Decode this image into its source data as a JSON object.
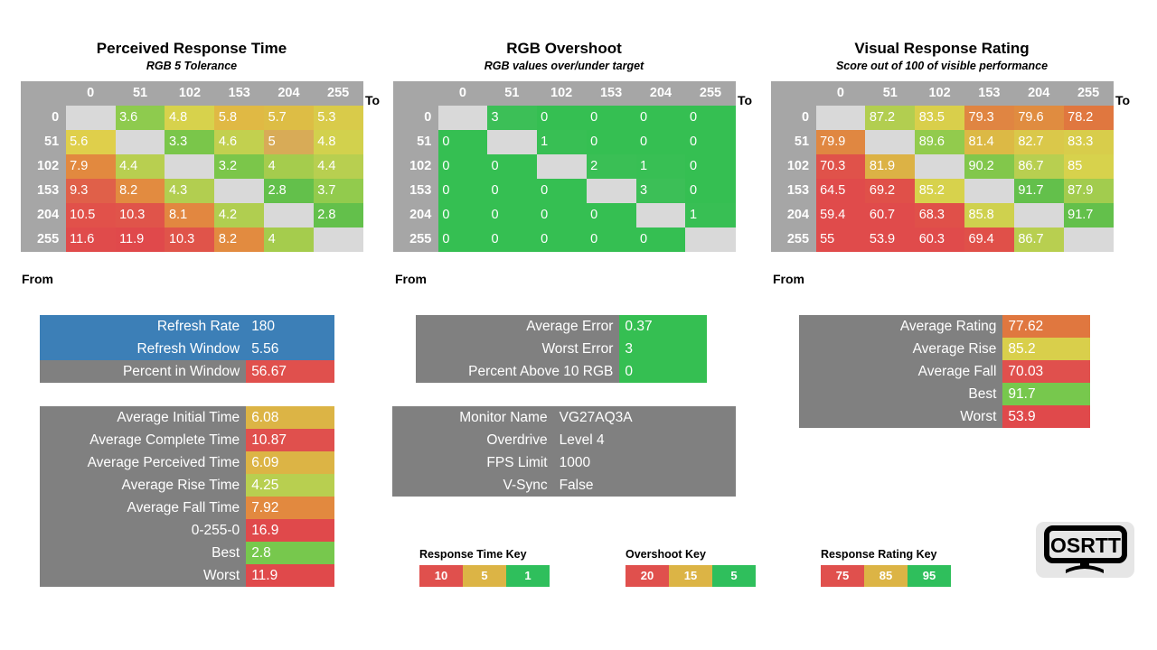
{
  "colors": {
    "header_grey": "#a6a6a6",
    "diag_grey": "#d9d9d9",
    "box_grey": "#808080",
    "blue": "#3c7fb7",
    "red": "#e0504d",
    "amber": "#dcb446",
    "green": "#2fbf5c",
    "logo_bg": "#e6e6e6"
  },
  "panels": [
    {
      "id": "perceived-response-time",
      "title": "Perceived Response Time",
      "subtitle": "RGB 5 Tolerance",
      "to_label": "To",
      "from_label": "From",
      "columns": [
        "0",
        "51",
        "102",
        "153",
        "204",
        "255"
      ],
      "rows": [
        "0",
        "51",
        "102",
        "153",
        "204",
        "255"
      ],
      "values": [
        [
          null,
          "3.6",
          "4.8",
          "5.8",
          "5.7",
          "5.3"
        ],
        [
          "5.6",
          null,
          "3.3",
          "4.6",
          "5",
          "4.8"
        ],
        [
          "7.9",
          "4.4",
          null,
          "3.2",
          "4",
          "4.4"
        ],
        [
          "9.3",
          "8.2",
          "4.3",
          null,
          "2.8",
          "3.7"
        ],
        [
          "10.5",
          "10.3",
          "8.1",
          "4.2",
          null,
          "2.8"
        ],
        [
          "11.6",
          "11.9",
          "10.3",
          "8.2",
          "4",
          null
        ]
      ],
      "cell_colors": [
        [
          null,
          "#8ecb4e",
          "#d7d24c",
          "#e0b944",
          "#ddbd45",
          "#d9cb4a"
        ],
        [
          "#dfcf4b",
          null,
          "#7ac64a",
          "#c2d04f",
          "#d8ab57",
          "#d2d14d"
        ],
        [
          "#e2893f",
          "#b8cf50",
          null,
          "#7bc64a",
          "#a5cc4d",
          "#b8cf50"
        ],
        [
          "#e06049",
          "#e28b40",
          "#b2ce50",
          null,
          "#63c04b",
          "#92cb4d"
        ],
        [
          "#e1514a",
          "#e0544a",
          "#e28740",
          "#b0ce50",
          null,
          "#63c04b"
        ],
        [
          "#e04b4b",
          "#e0494b",
          "#e0544a",
          "#e28b40",
          "#a5cc4d",
          null
        ]
      ]
    },
    {
      "id": "rgb-overshoot",
      "title": "RGB Overshoot",
      "subtitle": "RGB values over/under target",
      "to_label": "To",
      "from_label": "From",
      "columns": [
        "0",
        "51",
        "102",
        "153",
        "204",
        "255"
      ],
      "rows": [
        "0",
        "51",
        "102",
        "153",
        "204",
        "255"
      ],
      "values": [
        [
          null,
          "3",
          "0",
          "0",
          "0",
          "0"
        ],
        [
          "0",
          null,
          "1",
          "0",
          "0",
          "0"
        ],
        [
          "0",
          "0",
          null,
          "2",
          "1",
          "0"
        ],
        [
          "0",
          "0",
          "0",
          null,
          "3",
          "0"
        ],
        [
          "0",
          "0",
          "0",
          "0",
          null,
          "1"
        ],
        [
          "0",
          "0",
          "0",
          "0",
          "0",
          null
        ]
      ],
      "cell_colors": [
        [
          null,
          "#3cbf57",
          "#35bf52",
          "#35bf52",
          "#35bf52",
          "#35bf52"
        ],
        [
          "#35bf52",
          null,
          "#38bf54",
          "#35bf52",
          "#35bf52",
          "#35bf52"
        ],
        [
          "#35bf52",
          "#35bf52",
          null,
          "#3abf55",
          "#38bf54",
          "#35bf52"
        ],
        [
          "#35bf52",
          "#35bf52",
          "#35bf52",
          null,
          "#3cbf57",
          "#35bf52"
        ],
        [
          "#35bf52",
          "#35bf52",
          "#35bf52",
          "#35bf52",
          null,
          "#38bf54"
        ],
        [
          "#35bf52",
          "#35bf52",
          "#35bf52",
          "#35bf52",
          "#35bf52",
          null
        ]
      ]
    },
    {
      "id": "visual-response-rating",
      "title": "Visual Response Rating",
      "subtitle": "Score out of 100 of visible performance",
      "to_label": "To",
      "from_label": "From",
      "columns": [
        "0",
        "51",
        "102",
        "153",
        "204",
        "255"
      ],
      "rows": [
        "0",
        "51",
        "102",
        "153",
        "204",
        "255"
      ],
      "values": [
        [
          null,
          "87.2",
          "83.5",
          "79.3",
          "79.6",
          "78.2"
        ],
        [
          "79.9",
          null,
          "89.6",
          "81.4",
          "82.7",
          "83.3"
        ],
        [
          "70.3",
          "81.9",
          null,
          "90.2",
          "86.7",
          "85"
        ],
        [
          "64.5",
          "69.2",
          "85.2",
          null,
          "91.7",
          "87.9"
        ],
        [
          "59.4",
          "60.7",
          "68.3",
          "85.8",
          null,
          "91.7"
        ],
        [
          "55",
          "53.9",
          "60.3",
          "69.4",
          "86.7",
          null
        ]
      ],
      "cell_colors": [
        [
          null,
          "#b2ce50",
          "#d9cf4b",
          "#e08542",
          "#e08c40",
          "#e0773f"
        ],
        [
          "#e08741",
          null,
          "#92cb4d",
          "#dcb945",
          "#dac84a",
          "#d8cd4b"
        ],
        [
          "#e0524a",
          "#dcb245",
          null,
          "#82c74b",
          "#b8cf50",
          "#d7d24c"
        ],
        [
          "#e04b4b",
          "#e05049",
          "#d7d24c",
          null,
          "#63c04b",
          "#a2cc4e"
        ],
        [
          "#e04b4b",
          "#e04b4b",
          "#e05049",
          "#cfd14e",
          null,
          "#63c04b"
        ],
        [
          "#e04b4b",
          "#e04b4b",
          "#e04b4b",
          "#e05049",
          "#b8cf50",
          null
        ]
      ]
    }
  ],
  "summaries": {
    "refresh": {
      "id": "refresh-summary",
      "rows": [
        {
          "key": "Refresh Rate",
          "value": "180",
          "key_bg": "#3c7fb7",
          "value_bg": "#3c7fb7"
        },
        {
          "key": "Refresh Window",
          "value": "5.56",
          "key_bg": "#3c7fb7",
          "value_bg": "#3c7fb7"
        },
        {
          "key": "Percent in Window",
          "value": "56.67",
          "key_bg": "#808080",
          "value_bg": "#e0504d"
        }
      ]
    },
    "times": {
      "id": "response-time-summary",
      "rows": [
        {
          "key": "Average Initial Time",
          "value": "6.08",
          "key_bg": "#808080",
          "value_bg": "#dcb445"
        },
        {
          "key": "Average Complete Time",
          "value": "10.87",
          "key_bg": "#808080",
          "value_bg": "#e0504d"
        },
        {
          "key": "Average Perceived Time",
          "value": "6.09",
          "key_bg": "#808080",
          "value_bg": "#dcb445"
        },
        {
          "key": "Average Rise Time",
          "value": "4.25",
          "key_bg": "#808080",
          "value_bg": "#b8cf50"
        },
        {
          "key": "Average Fall Time",
          "value": "7.92",
          "key_bg": "#808080",
          "value_bg": "#e2893f"
        },
        {
          "key": "0-255-0",
          "value": "16.9",
          "key_bg": "#808080",
          "value_bg": "#e0494b"
        },
        {
          "key": "Best",
          "value": "2.8",
          "key_bg": "#808080",
          "value_bg": "#77c84d"
        },
        {
          "key": "Worst",
          "value": "11.9",
          "key_bg": "#808080",
          "value_bg": "#e0494b"
        }
      ]
    },
    "overshoot": {
      "id": "overshoot-summary",
      "rows": [
        {
          "key": "Average Error",
          "value": "0.37",
          "key_bg": "#808080",
          "value_bg": "#35bf52"
        },
        {
          "key": "Worst Error",
          "value": "3",
          "key_bg": "#808080",
          "value_bg": "#35bf52"
        },
        {
          "key": "Percent Above 10 RGB",
          "value": "0",
          "key_bg": "#808080",
          "value_bg": "#35bf52"
        }
      ]
    },
    "monitor": {
      "id": "monitor-info",
      "rows": [
        {
          "key": "Monitor Name",
          "value": "VG27AQ3A",
          "key_bg": "#808080",
          "value_bg": "#808080"
        },
        {
          "key": "Overdrive",
          "value": "Level 4",
          "key_bg": "#808080",
          "value_bg": "#808080"
        },
        {
          "key": "FPS Limit",
          "value": "1000",
          "key_bg": "#808080",
          "value_bg": "#808080"
        },
        {
          "key": "V-Sync",
          "value": "False",
          "key_bg": "#808080",
          "value_bg": "#808080"
        }
      ]
    },
    "rating": {
      "id": "rating-summary",
      "rows": [
        {
          "key": "Average Rating",
          "value": "77.62",
          "key_bg": "#808080",
          "value_bg": "#e0773f"
        },
        {
          "key": "Average Rise",
          "value": "85.2",
          "key_bg": "#808080",
          "value_bg": "#d9cf4b"
        },
        {
          "key": "Average Fall",
          "value": "70.03",
          "key_bg": "#808080",
          "value_bg": "#e0504d"
        },
        {
          "key": "Best",
          "value": "91.7",
          "key_bg": "#808080",
          "value_bg": "#77c84d"
        },
        {
          "key": "Worst",
          "value": "53.9",
          "key_bg": "#808080",
          "value_bg": "#e0494b"
        }
      ]
    }
  },
  "keys": [
    {
      "id": "response-time-key",
      "title": "Response Time Key",
      "stops": [
        {
          "label": "10",
          "color": "#e0504d"
        },
        {
          "label": "5",
          "color": "#dcb445"
        },
        {
          "label": "1",
          "color": "#2fbf5c"
        }
      ]
    },
    {
      "id": "overshoot-key",
      "title": "Overshoot Key",
      "stops": [
        {
          "label": "20",
          "color": "#e0504d"
        },
        {
          "label": "15",
          "color": "#dcb445"
        },
        {
          "label": "5",
          "color": "#2fbf5c"
        }
      ]
    },
    {
      "id": "response-rating-key",
      "title": "Response Rating Key",
      "stops": [
        {
          "label": "75",
          "color": "#e0504d"
        },
        {
          "label": "85",
          "color": "#dcb445"
        },
        {
          "label": "95",
          "color": "#2fbf5c"
        }
      ]
    }
  ],
  "logo": {
    "text": "OSRTT",
    "icon": "monitor-icon"
  },
  "chart_data": {
    "type": "heatmap",
    "title": "OSRTT Monitor Response Time Results",
    "charts": [
      {
        "type": "heatmap",
        "title": "Perceived Response Time",
        "subtitle": "RGB 5 Tolerance",
        "xlabel": "To",
        "ylabel": "From",
        "x": [
          0,
          51,
          102,
          153,
          204,
          255
        ],
        "y": [
          0,
          51,
          102,
          153,
          204,
          255
        ],
        "z": [
          [
            null,
            3.6,
            4.8,
            5.8,
            5.7,
            5.3
          ],
          [
            5.6,
            null,
            3.3,
            4.6,
            5,
            4.8
          ],
          [
            7.9,
            4.4,
            null,
            3.2,
            4,
            4.4
          ],
          [
            9.3,
            8.2,
            4.3,
            null,
            2.8,
            3.7
          ],
          [
            10.5,
            10.3,
            8.1,
            4.2,
            null,
            2.8
          ],
          [
            11.6,
            11.9,
            10.3,
            8.2,
            4,
            null
          ]
        ],
        "scale_key": {
          "10": "#e0504d",
          "5": "#dcb445",
          "1": "#2fbf5c"
        }
      },
      {
        "type": "heatmap",
        "title": "RGB Overshoot",
        "subtitle": "RGB values over/under target",
        "xlabel": "To",
        "ylabel": "From",
        "x": [
          0,
          51,
          102,
          153,
          204,
          255
        ],
        "y": [
          0,
          51,
          102,
          153,
          204,
          255
        ],
        "z": [
          [
            null,
            3,
            0,
            0,
            0,
            0
          ],
          [
            0,
            null,
            1,
            0,
            0,
            0
          ],
          [
            0,
            0,
            null,
            2,
            1,
            0
          ],
          [
            0,
            0,
            0,
            null,
            3,
            0
          ],
          [
            0,
            0,
            0,
            0,
            null,
            1
          ],
          [
            0,
            0,
            0,
            0,
            0,
            null
          ]
        ],
        "scale_key": {
          "20": "#e0504d",
          "15": "#dcb445",
          "5": "#2fbf5c"
        }
      },
      {
        "type": "heatmap",
        "title": "Visual Response Rating",
        "subtitle": "Score out of 100 of visible performance",
        "xlabel": "To",
        "ylabel": "From",
        "x": [
          0,
          51,
          102,
          153,
          204,
          255
        ],
        "y": [
          0,
          51,
          102,
          153,
          204,
          255
        ],
        "z": [
          [
            null,
            87.2,
            83.5,
            79.3,
            79.6,
            78.2
          ],
          [
            79.9,
            null,
            89.6,
            81.4,
            82.7,
            83.3
          ],
          [
            70.3,
            81.9,
            null,
            90.2,
            86.7,
            85
          ],
          [
            64.5,
            69.2,
            85.2,
            null,
            91.7,
            87.9
          ],
          [
            59.4,
            60.7,
            68.3,
            85.8,
            null,
            91.7
          ],
          [
            55,
            53.9,
            60.3,
            69.4,
            86.7,
            null
          ]
        ],
        "scale_key": {
          "75": "#e0504d",
          "85": "#dcb445",
          "95": "#2fbf5c"
        }
      }
    ],
    "summary_tables": {
      "refresh": {
        "Refresh Rate": 180,
        "Refresh Window": 5.56,
        "Percent in Window": 56.67
      },
      "response_times": {
        "Average Initial Time": 6.08,
        "Average Complete Time": 10.87,
        "Average Perceived Time": 6.09,
        "Average Rise Time": 4.25,
        "Average Fall Time": 7.92,
        "0-255-0": 16.9,
        "Best": 2.8,
        "Worst": 11.9
      },
      "overshoot": {
        "Average Error": 0.37,
        "Worst Error": 3,
        "Percent Above 10 RGB": 0
      },
      "monitor": {
        "Monitor Name": "VG27AQ3A",
        "Overdrive": "Level 4",
        "FPS Limit": 1000,
        "V-Sync": "False"
      },
      "rating": {
        "Average Rating": 77.62,
        "Average Rise": 85.2,
        "Average Fall": 70.03,
        "Best": 91.7,
        "Worst": 53.9
      }
    }
  }
}
